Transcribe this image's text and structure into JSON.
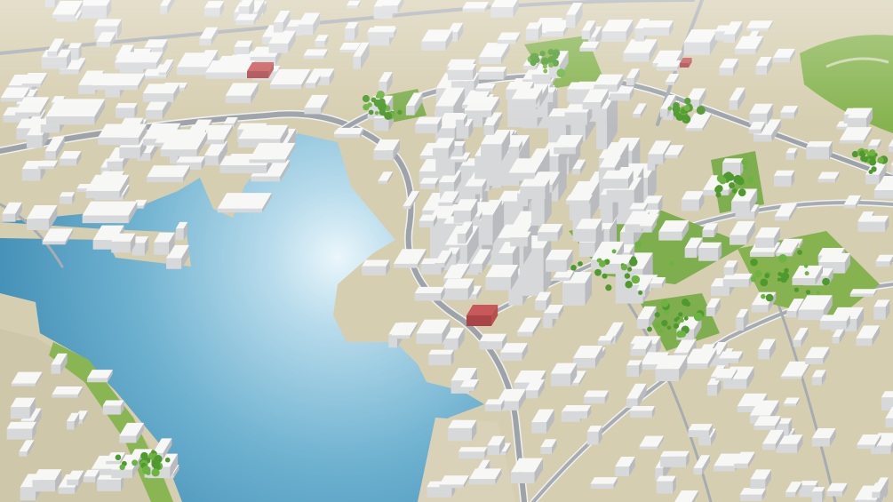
{
  "scene": {
    "subject": "aerial-3d-city-model",
    "colors": {
      "ground": "#d6ceb0",
      "road": "#a7acb3",
      "road_edge": "#eef0f1",
      "water_light": "#cfe9f3",
      "water": "#6fb2d0",
      "water_deep": "#3f8db5",
      "park": "#7fae4f",
      "park_light": "#a8c77a",
      "tree": "#4f9a2f",
      "building_top": "#f7f7f6",
      "building_side": "#d7d8da",
      "building_shadow": "#b9bbbe",
      "accent_red": "#c8585a"
    }
  }
}
